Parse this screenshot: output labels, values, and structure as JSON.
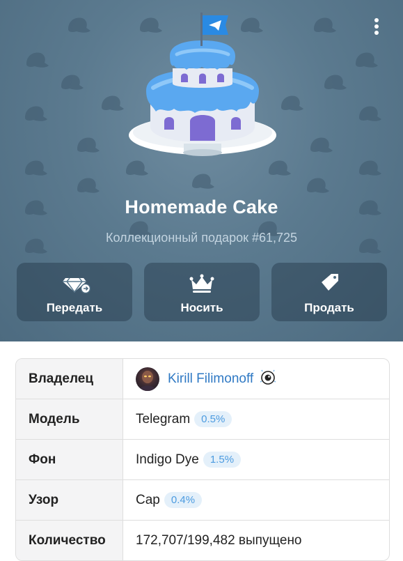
{
  "gift": {
    "title": "Homemade Cake",
    "subtitle": "Коллекционный подарок #61,725"
  },
  "actions": [
    {
      "label": "Передать",
      "icon": "gem-transfer-icon"
    },
    {
      "label": "Носить",
      "icon": "crown-icon"
    },
    {
      "label": "Продать",
      "icon": "tag-icon"
    }
  ],
  "details": {
    "owner_label": "Владелец",
    "owner_name": "Kirill Filimonoff",
    "model_label": "Модель",
    "model_value": "Telegram",
    "model_pct": "0.5%",
    "backdrop_label": "Фон",
    "backdrop_value": "Indigo Dye",
    "backdrop_pct": "1.5%",
    "pattern_label": "Узор",
    "pattern_value": "Cap",
    "pattern_pct": "0.4%",
    "quantity_label": "Количество",
    "quantity_value": "172,707/199,482 выпущено"
  },
  "colors": {
    "header_bg": "#5b7a8f",
    "link": "#2f79c4",
    "badge_bg": "#e4f0fa",
    "badge_text": "#4c9be0"
  }
}
